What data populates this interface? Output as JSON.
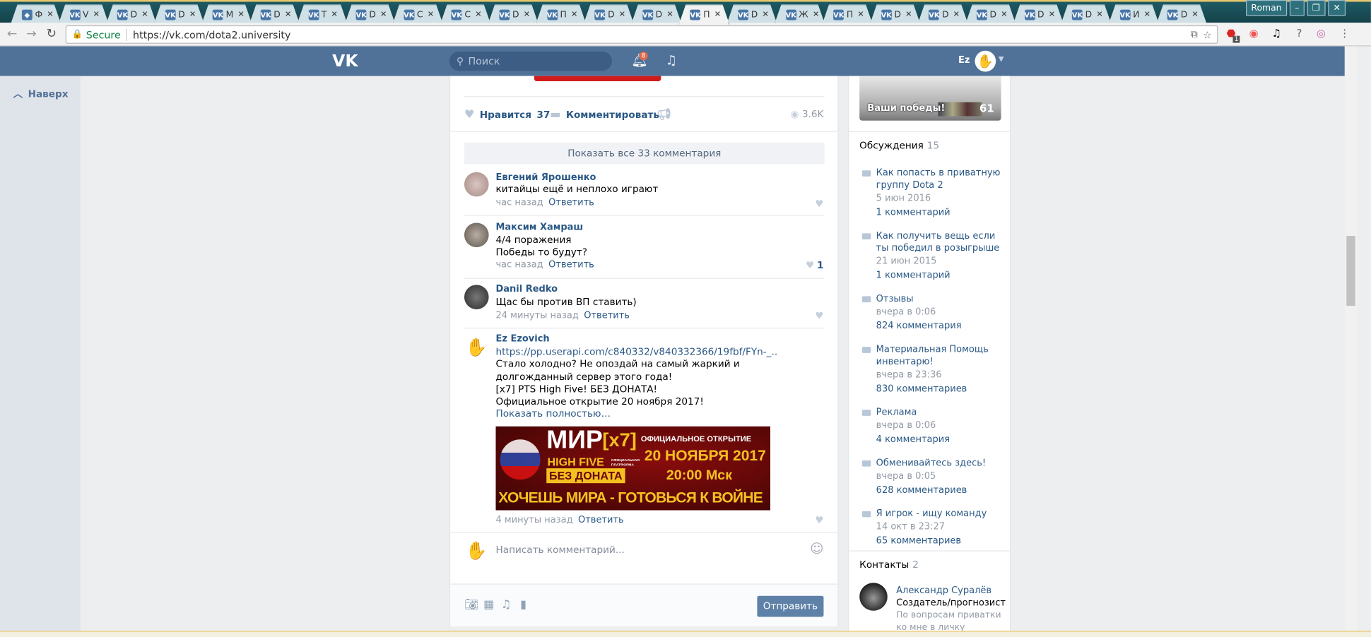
{
  "browser": {
    "tabs": [
      {
        "label": "Ф",
        "icon": "favicon-shield"
      },
      {
        "label": "V",
        "icon": "vk-icon"
      },
      {
        "label": "D",
        "icon": "vk-icon"
      },
      {
        "label": "D",
        "icon": "vk-icon"
      },
      {
        "label": "M",
        "icon": "vk-icon"
      },
      {
        "label": "D",
        "icon": "vk-icon"
      },
      {
        "label": "T",
        "icon": "vk-icon"
      },
      {
        "label": "D",
        "icon": "vk-icon"
      },
      {
        "label": "C",
        "icon": "vk-icon"
      },
      {
        "label": "C",
        "icon": "vk-icon"
      },
      {
        "label": "D",
        "icon": "vk-icon"
      },
      {
        "label": "П",
        "icon": "vk-icon"
      },
      {
        "label": "D",
        "icon": "vk-icon"
      },
      {
        "label": "D",
        "icon": "vk-icon"
      },
      {
        "label": "П",
        "icon": "vk-icon",
        "active": true
      },
      {
        "label": "D",
        "icon": "vk-icon"
      },
      {
        "label": "Ж",
        "icon": "vk-icon"
      },
      {
        "label": "П",
        "icon": "vk-icon"
      },
      {
        "label": "D",
        "icon": "vk-icon"
      },
      {
        "label": "D",
        "icon": "vk-icon"
      },
      {
        "label": "D",
        "icon": "vk-icon"
      },
      {
        "label": "D",
        "icon": "vk-icon"
      },
      {
        "label": "D",
        "icon": "vk-icon"
      },
      {
        "label": "И",
        "icon": "vk-icon"
      },
      {
        "label": "D",
        "icon": "vk-icon"
      }
    ],
    "user": "Roman",
    "secure_label": "Secure",
    "url": "https://vk.com/dota2.university",
    "extension_badge": "1"
  },
  "header": {
    "logo": "VK",
    "search_placeholder": "Поиск",
    "notifications_count": "8",
    "user_short": "Ez"
  },
  "left": {
    "to_top": "Наверх"
  },
  "post": {
    "likes_label": "Нравится",
    "likes_count": "37",
    "comment_label": "Комментировать",
    "views": "3.6K",
    "show_all": "Показать все 33 комментария",
    "comments": [
      {
        "author": "Евгений Ярошенко",
        "lines": [
          "китайцы ещё и неплохо играют"
        ],
        "time": "час назад",
        "reply": "Ответить",
        "likes": ""
      },
      {
        "author": "Максим Хамраш",
        "lines": [
          "4/4 поражения",
          "Победы то будут?"
        ],
        "time": "час назад",
        "reply": "Ответить",
        "likes": "1"
      },
      {
        "author": "Danil Redko",
        "lines": [
          "Щас бы против ВП ставить)"
        ],
        "time": "24 минуты назад",
        "reply": "Ответить",
        "likes": ""
      },
      {
        "author": "Ez Ezovich",
        "link": "https://pp.userapi.com/c840332/v840332366/19fbf/FYn-_..",
        "lines": [
          "Стало холодно? Не опоздай на самый жаркий и долгожданный сервер этого года!",
          "[x7] PTS High Five! БЕЗ ДОНАТА!",
          "Официальное открытие 20 ноября 2017!"
        ],
        "show_more": "Показать полностью…",
        "time": "4 минуты назад",
        "reply": "Ответить",
        "likes": ""
      }
    ],
    "banner": {
      "mir": "МИР",
      "x7": "[x7]",
      "high_five": "HIGH FIVE",
      "platform": "ОФИЦИАЛЬНАЯ ПЛАТФОРМА",
      "no_donate": "БЕЗ ДОНАТА",
      "opening": "ОФИЦИАЛЬНОЕ ОТКРЫТИЕ",
      "date": "20 НОЯБРЯ 2017",
      "time": "20:00 Мск",
      "slogan": "ХОЧЕШЬ МИРА - ГОТОВЬСЯ К ВОЙНЕ"
    },
    "composer_placeholder": "Написать комментарий...",
    "send_label": "Отправить"
  },
  "sidebar": {
    "album_title": "Ваши победы!",
    "album_count": "61",
    "discussions_label": "Обсуждения",
    "discussions_count": "15",
    "discussions": [
      {
        "title": "Как попасть в приватную группу Dota 2",
        "date": "5 июн 2016",
        "count": "1 комментарий"
      },
      {
        "title": "Как получить вещь если ты победил в розыгрыше",
        "date": "21 июн 2015",
        "count": "1 комментарий"
      },
      {
        "title": "Отзывы",
        "date": "вчера в 0:06",
        "count": "824 комментария"
      },
      {
        "title": "Материальная Помощь инвентарю!",
        "date": "вчера в 23:36",
        "count": "830 комментариев"
      },
      {
        "title": "Реклама",
        "date": "вчера в 0:06",
        "count": "4 комментария"
      },
      {
        "title": "Обменивайтесь здесь!",
        "date": "вчера в 0:05",
        "count": "628 комментариев"
      },
      {
        "title": "Я игрок - ищу команду",
        "date": "14 окт в 23:27",
        "count": "65 комментариев"
      }
    ],
    "contacts_label": "Контакты",
    "contacts_count": "2",
    "contact": {
      "name": "Александр Суралёв",
      "role": "Создатель/прогнозист",
      "note": "По вопросам приватки ко мне в личку"
    }
  },
  "colors": {
    "vk_blue": "#507299",
    "link": "#2a5885",
    "muted": "#939ba5",
    "red": "#d11b1b"
  }
}
